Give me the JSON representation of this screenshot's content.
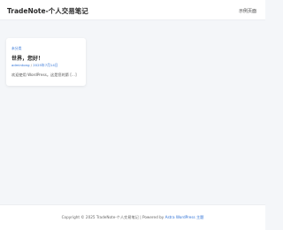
{
  "header": {
    "site_title": "TradeNote-个人交易笔记",
    "nav_link": "示例页面"
  },
  "post": {
    "category": "未分类",
    "title": "世界，您好！",
    "author": "admintong",
    "separator": "/",
    "date": "2025年7月14日",
    "excerpt": "欢迎使用 WordPress。这是您的第 [...]"
  },
  "footer": {
    "prefix": "Copyright © 2025 TradeNote-个人交易笔记 | Powered by",
    "theme_link": "Astra WordPress 主题"
  },
  "colors": {
    "accent": "#2f72d6",
    "background": "#f4f6f9"
  }
}
